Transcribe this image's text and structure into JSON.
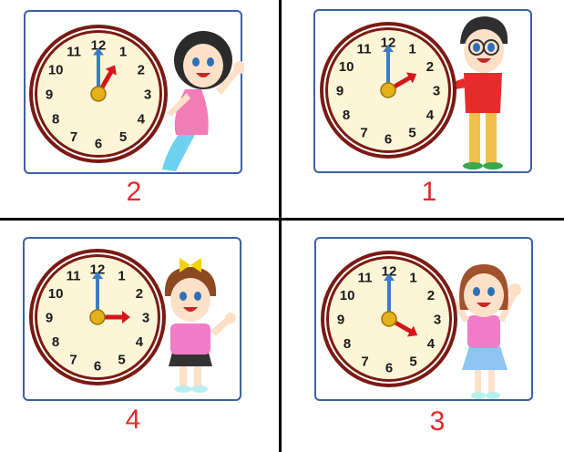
{
  "dial_numbers": [
    "12",
    "1",
    "2",
    "3",
    "4",
    "5",
    "6",
    "7",
    "8",
    "9",
    "10",
    "11"
  ],
  "colors": {
    "card_border": "#3d5fa8",
    "clock_rim": "#7a1a12",
    "clock_face": "#fdf5d8",
    "minute_hand": "#3b7cc9",
    "hour_hand": "#d4161b",
    "center_cap": "#e3b11a",
    "label": "#e8262b"
  },
  "panels": [
    {
      "label": "2",
      "hour": 1,
      "minute": 0,
      "character": "curly-haired-girl-pink-dress",
      "hair": "#2b2b2b",
      "shirt": "#f27bb8",
      "legs": "#6fd0ef"
    },
    {
      "label": "1",
      "hour": 2,
      "minute": 0,
      "character": "boy-with-glasses-red-shirt",
      "hair": "#2f2f2f",
      "shirt": "#e42c2c",
      "legs": "#f0c04a"
    },
    {
      "label": "4",
      "hour": 3,
      "minute": 0,
      "character": "girl-with-yellow-bow-thumbs-up",
      "hair": "#8b4a22",
      "shirt": "#f07cc8",
      "legs": "#333333"
    },
    {
      "label": "3",
      "hour": 4,
      "minute": 0,
      "character": "waving-girl-blue-skirt",
      "hair": "#a0522d",
      "shirt": "#f07cc8",
      "legs": "#8ec4ef"
    }
  ]
}
